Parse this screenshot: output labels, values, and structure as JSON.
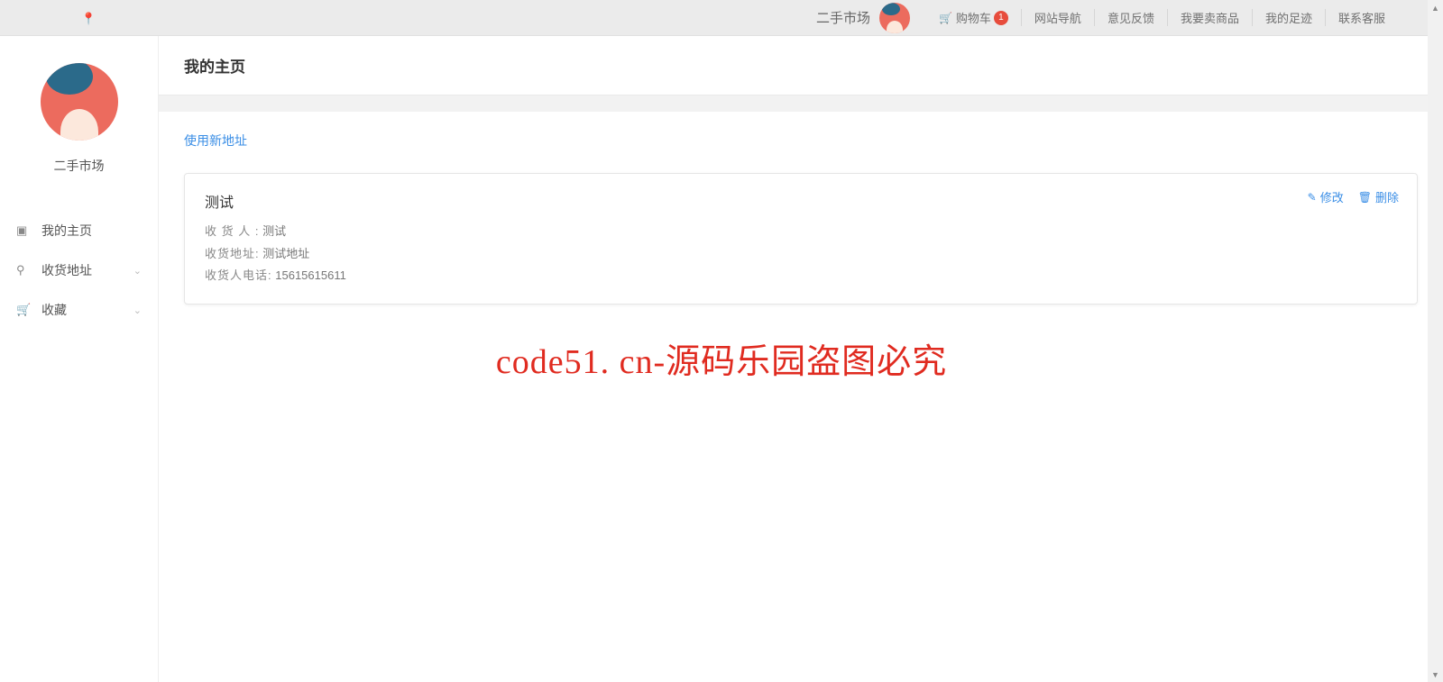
{
  "topbar": {
    "brand": "二手市场",
    "cart_label": "购物车",
    "cart_count": "1",
    "links": [
      "网站导航",
      "意见反馈",
      "我要卖商品",
      "我的足迹",
      "联系客服"
    ]
  },
  "sidebar": {
    "username": "二手市场",
    "menu": [
      {
        "label": "我的主页",
        "icon": "home-icon",
        "expandable": false
      },
      {
        "label": "收货地址",
        "icon": "pin-icon",
        "expandable": true
      },
      {
        "label": "收藏",
        "icon": "cart-icon",
        "expandable": true
      }
    ]
  },
  "page": {
    "title": "我的主页",
    "new_address_link": "使用新地址"
  },
  "address_card": {
    "title": "测试",
    "receiver_label": "收 货 人 :",
    "receiver_value": "测试",
    "address_label": "收货地址:",
    "address_value": "测试地址",
    "phone_label": "收货人电话:",
    "phone_value": "15615615611",
    "edit_action": "修改",
    "delete_action": "删除"
  },
  "watermark": "code51. cn-源码乐园盗图必究"
}
